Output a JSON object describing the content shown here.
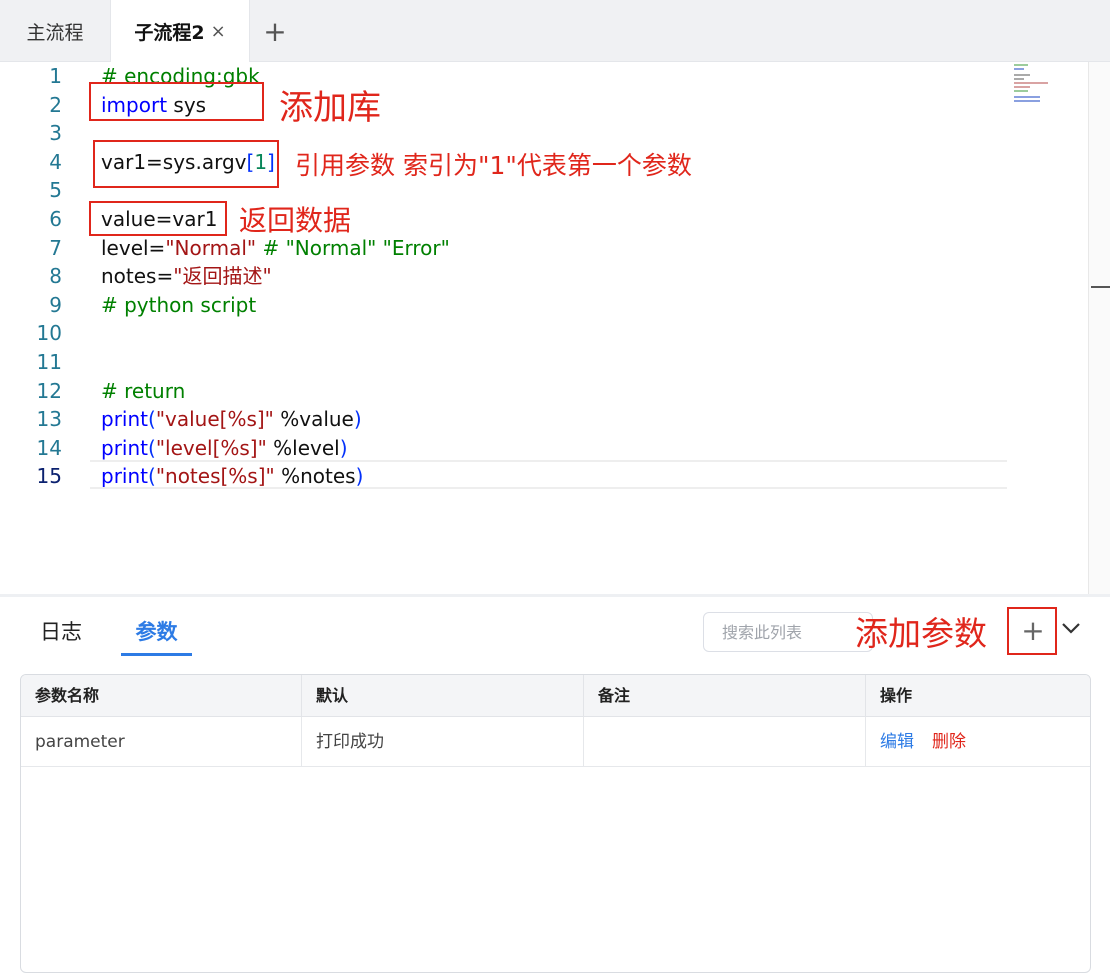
{
  "tabs": {
    "main_label": "主流程",
    "sub_label": "子流程2",
    "close_glyph": "×",
    "add_glyph": "+"
  },
  "editor": {
    "lines": [
      {
        "num": "1",
        "tokens": [
          {
            "t": "# encoding:gbk",
            "c": "c-comment"
          }
        ]
      },
      {
        "num": "2",
        "tokens": [
          {
            "t": "import",
            "c": "c-kw"
          },
          {
            "t": " sys",
            "c": ""
          }
        ]
      },
      {
        "num": "3",
        "tokens": []
      },
      {
        "num": "4",
        "tokens": [
          {
            "t": "var1=sys.argv",
            "c": ""
          },
          {
            "t": "[",
            "c": "c-br"
          },
          {
            "t": "1",
            "c": "c-num"
          },
          {
            "t": "]",
            "c": "c-br"
          }
        ]
      },
      {
        "num": "5",
        "tokens": []
      },
      {
        "num": "6",
        "tokens": [
          {
            "t": "value=var1",
            "c": ""
          }
        ]
      },
      {
        "num": "7",
        "tokens": [
          {
            "t": "level=",
            "c": ""
          },
          {
            "t": "\"Normal\"",
            "c": "c-str"
          },
          {
            "t": " # \"Normal\" \"Error\"",
            "c": "c-comment"
          }
        ]
      },
      {
        "num": "8",
        "tokens": [
          {
            "t": "notes=",
            "c": ""
          },
          {
            "t": "\"返回描述\"",
            "c": "c-str"
          }
        ]
      },
      {
        "num": "9",
        "tokens": [
          {
            "t": "# python script",
            "c": "c-comment"
          }
        ]
      },
      {
        "num": "10",
        "tokens": []
      },
      {
        "num": "11",
        "tokens": []
      },
      {
        "num": "12",
        "tokens": [
          {
            "t": "# return",
            "c": "c-comment"
          }
        ]
      },
      {
        "num": "13",
        "tokens": [
          {
            "t": "print",
            "c": "c-kw"
          },
          {
            "t": "(",
            "c": "c-br"
          },
          {
            "t": "\"value[%s]\"",
            "c": "c-str"
          },
          {
            "t": " %value",
            "c": ""
          },
          {
            "t": ")",
            "c": "c-br"
          }
        ]
      },
      {
        "num": "14",
        "tokens": [
          {
            "t": "print",
            "c": "c-kw"
          },
          {
            "t": "(",
            "c": "c-br"
          },
          {
            "t": "\"level[%s]\"",
            "c": "c-str"
          },
          {
            "t": " %level",
            "c": ""
          },
          {
            "t": ")",
            "c": "c-br"
          }
        ]
      },
      {
        "num": "15",
        "tokens": [
          {
            "t": "print",
            "c": "c-kw"
          },
          {
            "t": "(",
            "c": "c-br"
          },
          {
            "t": "\"notes[%s]\"",
            "c": "c-str"
          },
          {
            "t": " %notes",
            "c": ""
          },
          {
            "t": ")",
            "c": "c-br"
          }
        ]
      }
    ],
    "active_line": "15"
  },
  "annotations": {
    "add_library": "添加库",
    "argv_note": "引用参数 索引为\"1\"代表第一个参数",
    "return_data": "返回数据",
    "add_param": "添加参数"
  },
  "panel": {
    "tab_log": "日志",
    "tab_params": "参数",
    "search_placeholder": "搜索此列表",
    "add_glyph": "+",
    "table": {
      "headers": [
        "参数名称",
        "默认",
        "备注",
        "操作"
      ],
      "rows": [
        {
          "name": "parameter",
          "default": "打印成功",
          "note": "",
          "edit": "编辑",
          "delete": "删除"
        }
      ]
    }
  },
  "colors": {
    "accent": "#2d7be5",
    "annotation": "#e0261b"
  }
}
